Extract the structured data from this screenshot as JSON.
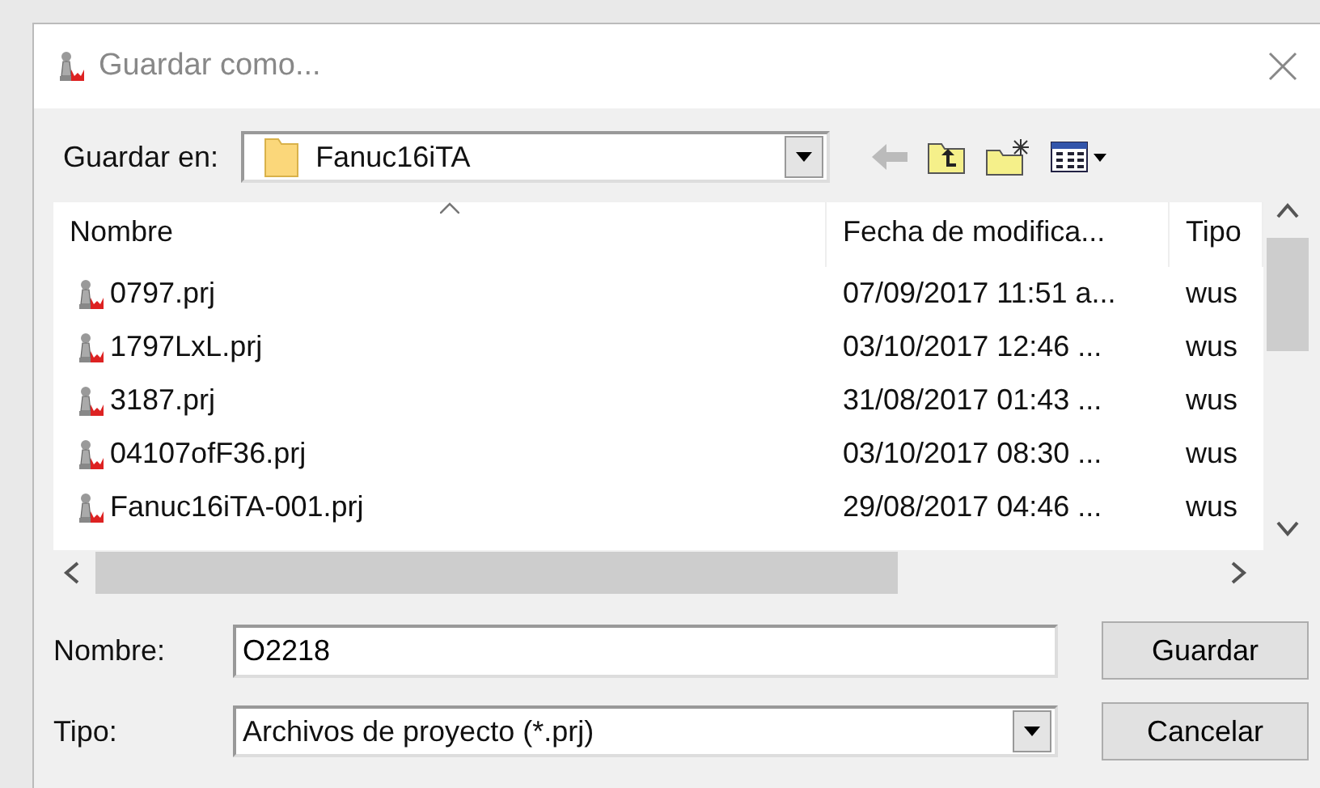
{
  "window": {
    "title": "Guardar como..."
  },
  "save_in": {
    "label": "Guardar en:",
    "value": "Fanuc16iTA"
  },
  "columns": [
    {
      "label": "Nombre",
      "sorted": true
    },
    {
      "label": "Fecha de modifica...",
      "sorted": false
    },
    {
      "label": "Tipo",
      "sorted": false
    }
  ],
  "rows": [
    {
      "name": "0797.prj",
      "date": "07/09/2017 11:51 a...",
      "type": "wus"
    },
    {
      "name": "1797LxL.prj",
      "date": "03/10/2017 12:46 ...",
      "type": "wus"
    },
    {
      "name": "3187.prj",
      "date": "31/08/2017 01:43 ...",
      "type": "wus"
    },
    {
      "name": "04107ofF36.prj",
      "date": "03/10/2017 08:30 ...",
      "type": "wus"
    },
    {
      "name": "Fanuc16iTA-001.prj",
      "date": "29/08/2017 04:46 ...",
      "type": "wus"
    }
  ],
  "file_name": {
    "label": "Nombre:",
    "value": "O2218"
  },
  "file_type": {
    "label": "Tipo:",
    "value": "Archivos de proyecto (*.prj)"
  },
  "buttons": [
    "Guardar",
    "Cancelar"
  ]
}
